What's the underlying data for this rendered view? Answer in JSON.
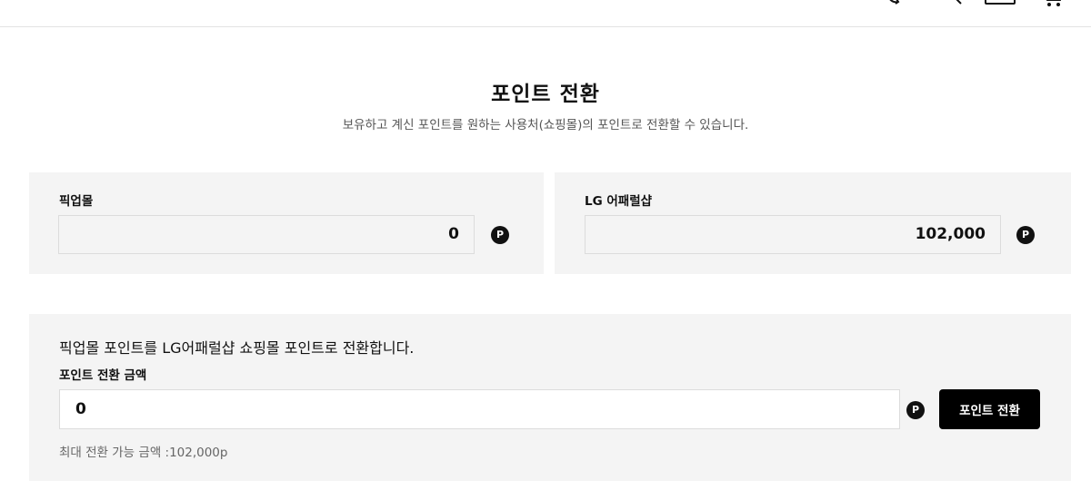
{
  "header": {
    "icons": [
      "swap-icon",
      "search-icon",
      "wallet-icon",
      "cart-icon"
    ]
  },
  "page": {
    "title": "포인트 전환",
    "subtitle": "보유하고 계신 포인트를 원하는 사용처(쇼핑몰)의 포인트로 전환할 수 있습니다."
  },
  "balances": [
    {
      "label": "픽업몰",
      "value": "0",
      "icon_text": "P"
    },
    {
      "label": "LG 어패럴샵",
      "value": "102,000",
      "icon_text": "P"
    }
  ],
  "convert": {
    "description": "픽업몰 포인트를 LG어패럴샵 쇼핑몰 포인트로 전환합니다.",
    "amount_label": "포인트 전환 금액",
    "amount_value": "0",
    "icon_text": "P",
    "button_label": "포인트 전환",
    "max_text": "최대 전환 가능 금액 :102,000p"
  },
  "colors": {
    "panel_bg": "#f4f4f4",
    "button_bg": "#000000",
    "accent_text": "#111111"
  }
}
